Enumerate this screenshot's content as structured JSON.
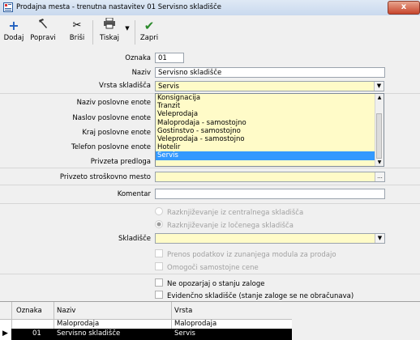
{
  "window": {
    "title": "Prodajna mesta - trenutna nastavitev 01 Servisno skladišče",
    "close": "x"
  },
  "toolbar": {
    "dodaj": "Dodaj",
    "popravi": "Popravi",
    "brisi": "Briši",
    "tiskaj": "Tiskaj",
    "zapri": "Zapri"
  },
  "form": {
    "oznaka_label": "Oznaka",
    "oznaka_value": "01",
    "naziv_label": "Naziv",
    "naziv_value": "Servisno skladišče",
    "vrsta_label": "Vrsta skladišča",
    "vrsta_value": "Servis",
    "naziv_pe_label": "Naziv poslovne enote",
    "naslov_pe_label": "Naslov poslovne enote",
    "kraj_pe_label": "Kraj poslovne enote",
    "telefon_pe_label": "Telefon poslovne enote",
    "predloga_label": "Privzeta predloga",
    "strosek_label": "Privzeto stroškovno mesto",
    "strosek_btn": "...",
    "komentar_label": "Komentar",
    "skladisce_label": "Skladišče"
  },
  "dropdown": {
    "options": [
      "Konsignacija",
      "Tranzit",
      "Veleprodaja",
      "Maloprodaja - samostojno",
      "Gostinstvo - samostojno",
      "Veleprodaja - samostojno",
      "Hotelir",
      "Servis"
    ],
    "selected_index": 7
  },
  "options": {
    "razkn_central": "Razknjiževanje iz centralnega skladišča",
    "razkn_locen": "Razknjiževanje iz ločenega skladišča",
    "prenos": "Prenos podatkov iz zunanjega modula za prodajo",
    "omogoci": "Omogoči samostojne cene",
    "ne_opozarjaj": "Ne opozarjaj o stanju zaloge",
    "evidencno": "Evidenčno skladišče (stanje zaloge se ne obračunava)"
  },
  "grid": {
    "headers": [
      "Oznaka",
      "Naziv",
      "Vrsta"
    ],
    "rows": [
      {
        "oznaka": "",
        "naziv": "Maloprodaja",
        "vrsta": "Maloprodaja"
      },
      {
        "oznaka": "01",
        "naziv": "Servisno skladišče",
        "vrsta": "Servis"
      }
    ]
  },
  "colors": {
    "accent_yellow": "#fffbc8",
    "selection": "#3399ff",
    "close_red": "#c7452c"
  }
}
